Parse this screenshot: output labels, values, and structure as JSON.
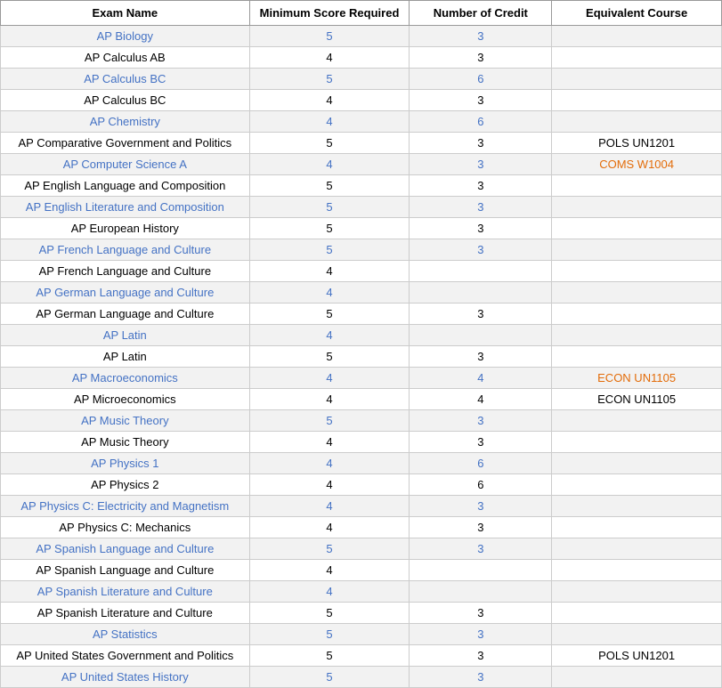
{
  "table": {
    "headers": [
      "Exam Name",
      "Minimum Score Required",
      "Number of Credit",
      "Equivalent Course"
    ],
    "rows": [
      {
        "name": "AP Biology",
        "nameColor": "blue",
        "minScore": "5",
        "minColor": "blue",
        "numCredit": "3",
        "numColor": "blue",
        "equiv": "",
        "equivColor": "black"
      },
      {
        "name": "AP Calculus AB",
        "nameColor": "black",
        "minScore": "4",
        "minColor": "black",
        "numCredit": "3",
        "numColor": "black",
        "equiv": "",
        "equivColor": "black"
      },
      {
        "name": "AP Calculus BC",
        "nameColor": "blue",
        "minScore": "5",
        "minColor": "blue",
        "numCredit": "6",
        "numColor": "blue",
        "equiv": "",
        "equivColor": "black"
      },
      {
        "name": "AP Calculus BC",
        "nameColor": "black",
        "minScore": "4",
        "minColor": "black",
        "numCredit": "3",
        "numColor": "black",
        "equiv": "",
        "equivColor": "black"
      },
      {
        "name": "AP Chemistry",
        "nameColor": "blue",
        "minScore": "4",
        "minColor": "blue",
        "numCredit": "6",
        "numColor": "blue",
        "equiv": "",
        "equivColor": "black"
      },
      {
        "name": "AP Comparative Government and Politics",
        "nameColor": "black",
        "minScore": "5",
        "minColor": "black",
        "numCredit": "3",
        "numColor": "black",
        "equiv": "POLS UN1201",
        "equivColor": "black"
      },
      {
        "name": "AP Computer Science A",
        "nameColor": "blue",
        "minScore": "4",
        "minColor": "blue",
        "numCredit": "3",
        "numColor": "blue",
        "equiv": "COMS W1004",
        "equivColor": "orange"
      },
      {
        "name": "AP English Language and Composition",
        "nameColor": "black",
        "minScore": "5",
        "minColor": "black",
        "numCredit": "3",
        "numColor": "black",
        "equiv": "",
        "equivColor": "black"
      },
      {
        "name": "AP English Literature and Composition",
        "nameColor": "blue",
        "minScore": "5",
        "minColor": "blue",
        "numCredit": "3",
        "numColor": "blue",
        "equiv": "",
        "equivColor": "black"
      },
      {
        "name": "AP European History",
        "nameColor": "black",
        "minScore": "5",
        "minColor": "black",
        "numCredit": "3",
        "numColor": "black",
        "equiv": "",
        "equivColor": "black"
      },
      {
        "name": "AP French Language and Culture",
        "nameColor": "blue",
        "minScore": "5",
        "minColor": "blue",
        "numCredit": "3",
        "numColor": "blue",
        "equiv": "",
        "equivColor": "black"
      },
      {
        "name": "AP French Language and Culture",
        "nameColor": "black",
        "minScore": "4",
        "minColor": "black",
        "numCredit": "",
        "numColor": "black",
        "equiv": "",
        "equivColor": "black"
      },
      {
        "name": "AP German Language and Culture",
        "nameColor": "blue",
        "minScore": "4",
        "minColor": "blue",
        "numCredit": "",
        "numColor": "black",
        "equiv": "",
        "equivColor": "black"
      },
      {
        "name": "AP German Language and Culture",
        "nameColor": "black",
        "minScore": "5",
        "minColor": "black",
        "numCredit": "3",
        "numColor": "black",
        "equiv": "",
        "equivColor": "black"
      },
      {
        "name": "AP Latin",
        "nameColor": "blue",
        "minScore": "4",
        "minColor": "blue",
        "numCredit": "",
        "numColor": "black",
        "equiv": "",
        "equivColor": "black"
      },
      {
        "name": "AP Latin",
        "nameColor": "black",
        "minScore": "5",
        "minColor": "black",
        "numCredit": "3",
        "numColor": "black",
        "equiv": "",
        "equivColor": "black"
      },
      {
        "name": "AP Macroeconomics",
        "nameColor": "blue",
        "minScore": "4",
        "minColor": "blue",
        "numCredit": "4",
        "numColor": "blue",
        "equiv": "ECON UN1105",
        "equivColor": "orange"
      },
      {
        "name": "AP Microeconomics",
        "nameColor": "black",
        "minScore": "4",
        "minColor": "black",
        "numCredit": "4",
        "numColor": "black",
        "equiv": "ECON UN1105",
        "equivColor": "black"
      },
      {
        "name": "AP Music Theory",
        "nameColor": "blue",
        "minScore": "5",
        "minColor": "blue",
        "numCredit": "3",
        "numColor": "blue",
        "equiv": "",
        "equivColor": "black"
      },
      {
        "name": "AP Music Theory",
        "nameColor": "black",
        "minScore": "4",
        "minColor": "black",
        "numCredit": "3",
        "numColor": "black",
        "equiv": "",
        "equivColor": "black"
      },
      {
        "name": "AP Physics 1",
        "nameColor": "blue",
        "minScore": "4",
        "minColor": "blue",
        "numCredit": "6",
        "numColor": "blue",
        "equiv": "",
        "equivColor": "black"
      },
      {
        "name": "AP Physics 2",
        "nameColor": "black",
        "minScore": "4",
        "minColor": "black",
        "numCredit": "6",
        "numColor": "black",
        "equiv": "",
        "equivColor": "black"
      },
      {
        "name": "AP Physics C: Electricity and Magnetism",
        "nameColor": "blue",
        "minScore": "4",
        "minColor": "blue",
        "numCredit": "3",
        "numColor": "blue",
        "equiv": "",
        "equivColor": "black"
      },
      {
        "name": "AP Physics C: Mechanics",
        "nameColor": "black",
        "minScore": "4",
        "minColor": "black",
        "numCredit": "3",
        "numColor": "black",
        "equiv": "",
        "equivColor": "black"
      },
      {
        "name": "AP Spanish Language and Culture",
        "nameColor": "blue",
        "minScore": "5",
        "minColor": "blue",
        "numCredit": "3",
        "numColor": "blue",
        "equiv": "",
        "equivColor": "black"
      },
      {
        "name": "AP Spanish Language and Culture",
        "nameColor": "black",
        "minScore": "4",
        "minColor": "black",
        "numCredit": "",
        "numColor": "black",
        "equiv": "",
        "equivColor": "black"
      },
      {
        "name": "AP Spanish Literature and Culture",
        "nameColor": "blue",
        "minScore": "4",
        "minColor": "blue",
        "numCredit": "",
        "numColor": "black",
        "equiv": "",
        "equivColor": "black"
      },
      {
        "name": "AP Spanish Literature and Culture",
        "nameColor": "black",
        "minScore": "5",
        "minColor": "black",
        "numCredit": "3",
        "numColor": "black",
        "equiv": "",
        "equivColor": "black"
      },
      {
        "name": "AP Statistics",
        "nameColor": "blue",
        "minScore": "5",
        "minColor": "blue",
        "numCredit": "3",
        "numColor": "blue",
        "equiv": "",
        "equivColor": "black"
      },
      {
        "name": "AP United States Government and Politics",
        "nameColor": "black",
        "minScore": "5",
        "minColor": "black",
        "numCredit": "3",
        "numColor": "black",
        "equiv": "POLS UN1201",
        "equivColor": "black"
      },
      {
        "name": "AP United States History",
        "nameColor": "blue",
        "minScore": "5",
        "minColor": "blue",
        "numCredit": "3",
        "numColor": "blue",
        "equiv": "",
        "equivColor": "black"
      }
    ]
  }
}
